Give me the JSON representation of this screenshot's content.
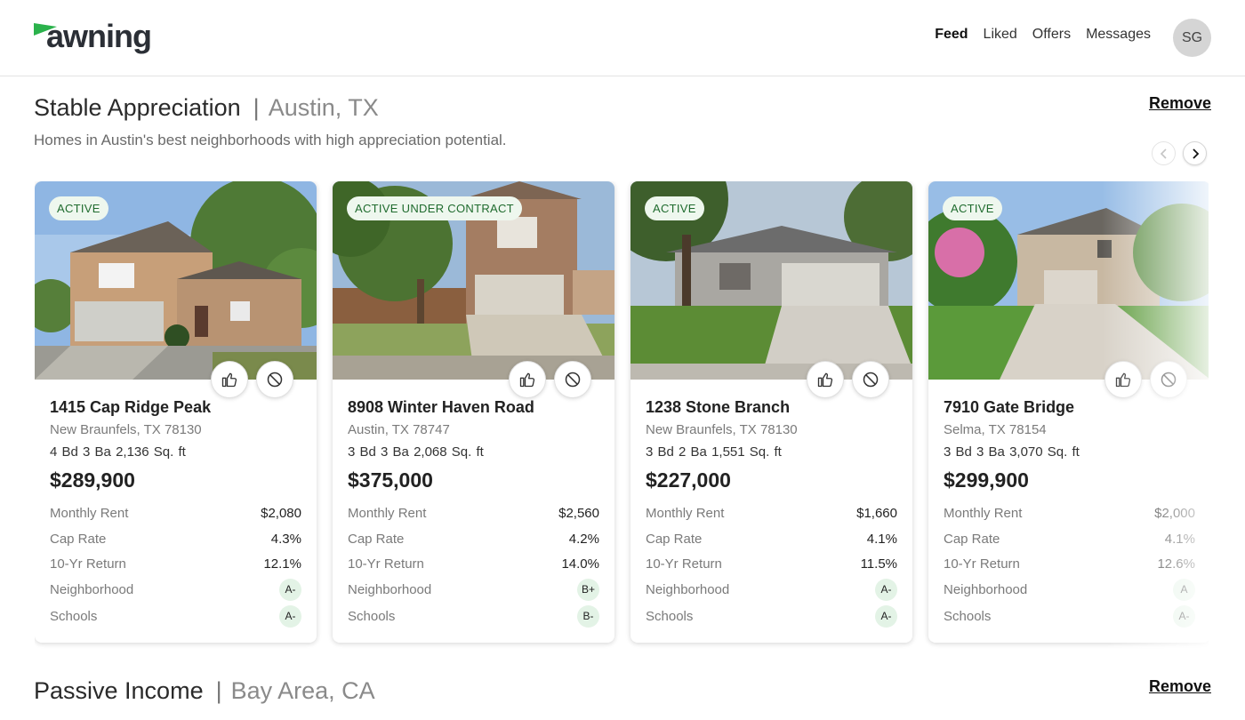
{
  "brand": {
    "name": "awning",
    "accent": "#2bb24c"
  },
  "nav": {
    "items": [
      "Feed",
      "Liked",
      "Offers",
      "Messages"
    ],
    "active": "Feed"
  },
  "user": {
    "initials": "SG"
  },
  "sections": [
    {
      "title": "Stable Appreciation",
      "location": "Austin, TX",
      "remove_label": "Remove",
      "subtitle": "Homes in Austin's best neighborhoods with high appreciation potential.",
      "prev_icon": "chevron-left-icon",
      "next_icon": "chevron-right-icon",
      "listings": [
        {
          "status": "ACTIVE",
          "address": "1415 Cap Ridge Peak",
          "city": "New Braunfels, TX 78130",
          "beds": "4 Bd",
          "baths": "3 Ba",
          "sqft": "2,136 Sq. ft",
          "price": "$289,900",
          "metrics": [
            {
              "label": "Monthly Rent",
              "value": "$2,080"
            },
            {
              "label": "Cap Rate",
              "value": "4.3%"
            },
            {
              "label": "10-Yr Return",
              "value": "12.1%"
            }
          ],
          "grades": [
            {
              "label": "Neighborhood",
              "value": "A-"
            },
            {
              "label": "Schools",
              "value": "A-"
            }
          ]
        },
        {
          "status": "ACTIVE UNDER CONTRACT",
          "address": "8908 Winter Haven Road",
          "city": "Austin, TX 78747",
          "beds": "3 Bd",
          "baths": "3 Ba",
          "sqft": "2,068 Sq. ft",
          "price": "$375,000",
          "metrics": [
            {
              "label": "Monthly Rent",
              "value": "$2,560"
            },
            {
              "label": "Cap Rate",
              "value": "4.2%"
            },
            {
              "label": "10-Yr Return",
              "value": "14.0%"
            }
          ],
          "grades": [
            {
              "label": "Neighborhood",
              "value": "B+"
            },
            {
              "label": "Schools",
              "value": "B-"
            }
          ]
        },
        {
          "status": "ACTIVE",
          "address": "1238 Stone Branch",
          "city": "New Braunfels, TX 78130",
          "beds": "3 Bd",
          "baths": "2 Ba",
          "sqft": "1,551 Sq. ft",
          "price": "$227,000",
          "metrics": [
            {
              "label": "Monthly Rent",
              "value": "$1,660"
            },
            {
              "label": "Cap Rate",
              "value": "4.1%"
            },
            {
              "label": "10-Yr Return",
              "value": "11.5%"
            }
          ],
          "grades": [
            {
              "label": "Neighborhood",
              "value": "A-"
            },
            {
              "label": "Schools",
              "value": "A-"
            }
          ]
        },
        {
          "status": "ACTIVE",
          "address": "7910 Gate Bridge",
          "city": "Selma, TX 78154",
          "beds": "3 Bd",
          "baths": "3 Ba",
          "sqft": "3,070 Sq. ft",
          "price": "$299,900",
          "metrics": [
            {
              "label": "Monthly Rent",
              "value": "$2,000"
            },
            {
              "label": "Cap Rate",
              "value": "4.1%"
            },
            {
              "label": "10-Yr Return",
              "value": "12.6%"
            }
          ],
          "grades": [
            {
              "label": "Neighborhood",
              "value": "A"
            },
            {
              "label": "Schools",
              "value": "A-"
            }
          ]
        }
      ]
    },
    {
      "title": "Passive Income",
      "location": "Bay Area, CA",
      "remove_label": "Remove"
    }
  ]
}
